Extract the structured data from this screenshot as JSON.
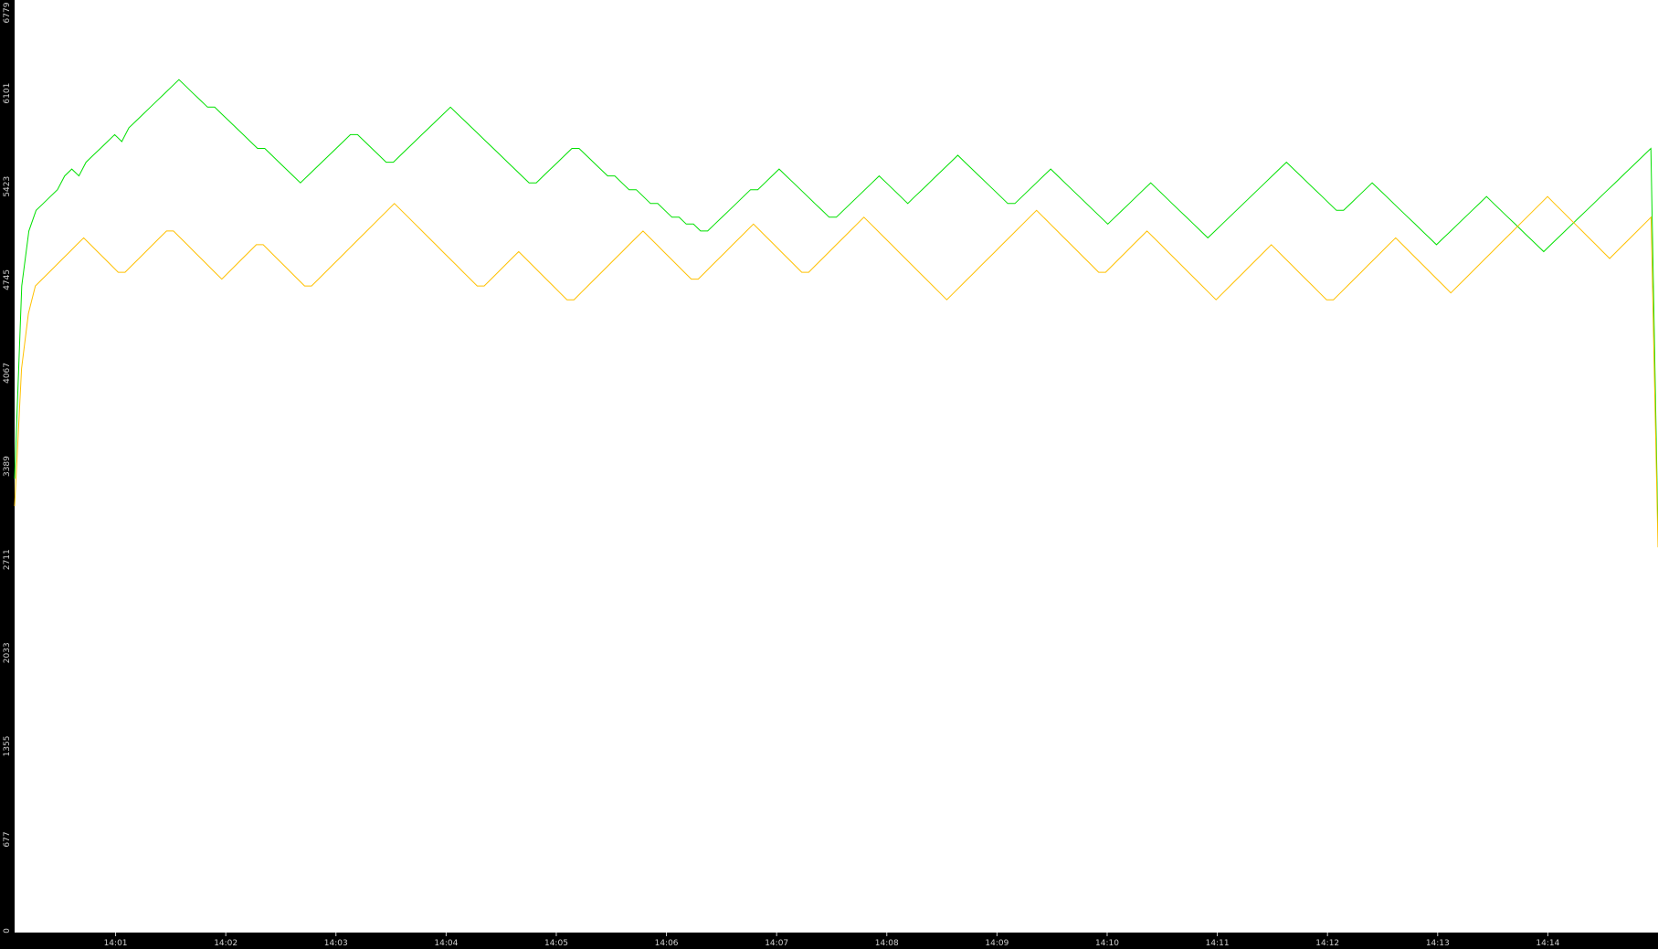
{
  "chart_data": {
    "type": "line",
    "title": "",
    "xlabel": "",
    "ylabel": "",
    "background": "#000000",
    "plot_background": "#ffffff",
    "ylim": [
      0,
      6779
    ],
    "y_ticks": [
      "0",
      "677",
      "1355",
      "2033",
      "2711",
      "3389",
      "4067",
      "4745",
      "5423",
      "6101",
      "6779"
    ],
    "x_ticks": [
      "14:01",
      "14:02",
      "14:03",
      "14:04",
      "14:05",
      "14:06",
      "14:07",
      "14:08",
      "14:09",
      "14:10",
      "14:11",
      "14:12",
      "14:13",
      "14:14"
    ],
    "x_start": "14:00:05",
    "x_end": "14:15:00",
    "grid": false,
    "legend": "none",
    "series": [
      {
        "color": "#00e000",
        "values": [
          3300,
          4700,
          5100,
          5250,
          5300,
          5350,
          5400,
          5500,
          5550,
          5500,
          5600,
          5650,
          5700,
          5750,
          5800,
          5750,
          5850,
          5900,
          5950,
          6000,
          6050,
          6100,
          6150,
          6200,
          6150,
          6100,
          6050,
          6000,
          6000,
          5950,
          5900,
          5850,
          5800,
          5750,
          5700,
          5700,
          5650,
          5600,
          5550,
          5500,
          5450,
          5500,
          5550,
          5600,
          5650,
          5700,
          5750,
          5800,
          5800,
          5750,
          5700,
          5650,
          5600,
          5600,
          5650,
          5700,
          5750,
          5800,
          5850,
          5900,
          5950,
          6000,
          5950,
          5900,
          5850,
          5800,
          5750,
          5700,
          5650,
          5600,
          5550,
          5500,
          5450,
          5450,
          5500,
          5550,
          5600,
          5650,
          5700,
          5700,
          5650,
          5600,
          5550,
          5500,
          5500,
          5450,
          5400,
          5400,
          5350,
          5300,
          5300,
          5250,
          5200,
          5200,
          5150,
          5150,
          5100,
          5100,
          5150,
          5200,
          5250,
          5300,
          5350,
          5400,
          5400,
          5450,
          5500,
          5550,
          5500,
          5450,
          5400,
          5350,
          5300,
          5250,
          5200,
          5200,
          5250,
          5300,
          5350,
          5400,
          5450,
          5500,
          5450,
          5400,
          5350,
          5300,
          5350,
          5400,
          5450,
          5500,
          5550,
          5600,
          5650,
          5600,
          5550,
          5500,
          5450,
          5400,
          5350,
          5300,
          5300,
          5350,
          5400,
          5450,
          5500,
          5550,
          5500,
          5450,
          5400,
          5350,
          5300,
          5250,
          5200,
          5150,
          5200,
          5250,
          5300,
          5350,
          5400,
          5450,
          5400,
          5350,
          5300,
          5250,
          5200,
          5150,
          5100,
          5050,
          5100,
          5150,
          5200,
          5250,
          5300,
          5350,
          5400,
          5450,
          5500,
          5550,
          5600,
          5550,
          5500,
          5450,
          5400,
          5350,
          5300,
          5250,
          5250,
          5300,
          5350,
          5400,
          5450,
          5400,
          5350,
          5300,
          5250,
          5200,
          5150,
          5100,
          5050,
          5000,
          5050,
          5100,
          5150,
          5200,
          5250,
          5300,
          5350,
          5300,
          5250,
          5200,
          5150,
          5100,
          5050,
          5000,
          4950,
          5000,
          5050,
          5100,
          5150,
          5200,
          5250,
          5300,
          5350,
          5400,
          5450,
          5500,
          5550,
          5600,
          5650,
          5700,
          2900
        ]
      },
      {
        "color": "#ffc000",
        "values": [
          3100,
          4100,
          4500,
          4700,
          4750,
          4800,
          4850,
          4900,
          4950,
          5000,
          5050,
          5000,
          4950,
          4900,
          4850,
          4800,
          4800,
          4850,
          4900,
          4950,
          5000,
          5050,
          5100,
          5100,
          5050,
          5000,
          4950,
          4900,
          4850,
          4800,
          4750,
          4800,
          4850,
          4900,
          4950,
          5000,
          5000,
          4950,
          4900,
          4850,
          4800,
          4750,
          4700,
          4700,
          4750,
          4800,
          4850,
          4900,
          4950,
          5000,
          5050,
          5100,
          5150,
          5200,
          5250,
          5300,
          5250,
          5200,
          5150,
          5100,
          5050,
          5000,
          4950,
          4900,
          4850,
          4800,
          4750,
          4700,
          4700,
          4750,
          4800,
          4850,
          4900,
          4950,
          4900,
          4850,
          4800,
          4750,
          4700,
          4650,
          4600,
          4600,
          4650,
          4700,
          4750,
          4800,
          4850,
          4900,
          4950,
          5000,
          5050,
          5100,
          5050,
          5000,
          4950,
          4900,
          4850,
          4800,
          4750,
          4750,
          4800,
          4850,
          4900,
          4950,
          5000,
          5050,
          5100,
          5150,
          5100,
          5050,
          5000,
          4950,
          4900,
          4850,
          4800,
          4800,
          4850,
          4900,
          4950,
          5000,
          5050,
          5100,
          5150,
          5200,
          5150,
          5100,
          5050,
          5000,
          4950,
          4900,
          4850,
          4800,
          4750,
          4700,
          4650,
          4600,
          4650,
          4700,
          4750,
          4800,
          4850,
          4900,
          4950,
          5000,
          5050,
          5100,
          5150,
          5200,
          5250,
          5200,
          5150,
          5100,
          5050,
          5000,
          4950,
          4900,
          4850,
          4800,
          4800,
          4850,
          4900,
          4950,
          5000,
          5050,
          5100,
          5050,
          5000,
          4950,
          4900,
          4850,
          4800,
          4750,
          4700,
          4650,
          4600,
          4650,
          4700,
          4750,
          4800,
          4850,
          4900,
          4950,
          5000,
          4950,
          4900,
          4850,
          4800,
          4750,
          4700,
          4650,
          4600,
          4600,
          4650,
          4700,
          4750,
          4800,
          4850,
          4900,
          4950,
          5000,
          5050,
          5000,
          4950,
          4900,
          4850,
          4800,
          4750,
          4700,
          4650,
          4700,
          4750,
          4800,
          4850,
          4900,
          4950,
          5000,
          5050,
          5100,
          5150,
          5200,
          5250,
          5300,
          5350,
          5300,
          5250,
          5200,
          5150,
          5100,
          5050,
          5000,
          4950,
          4900,
          4950,
          5000,
          5050,
          5100,
          5150,
          5200,
          2800
        ]
      }
    ]
  }
}
